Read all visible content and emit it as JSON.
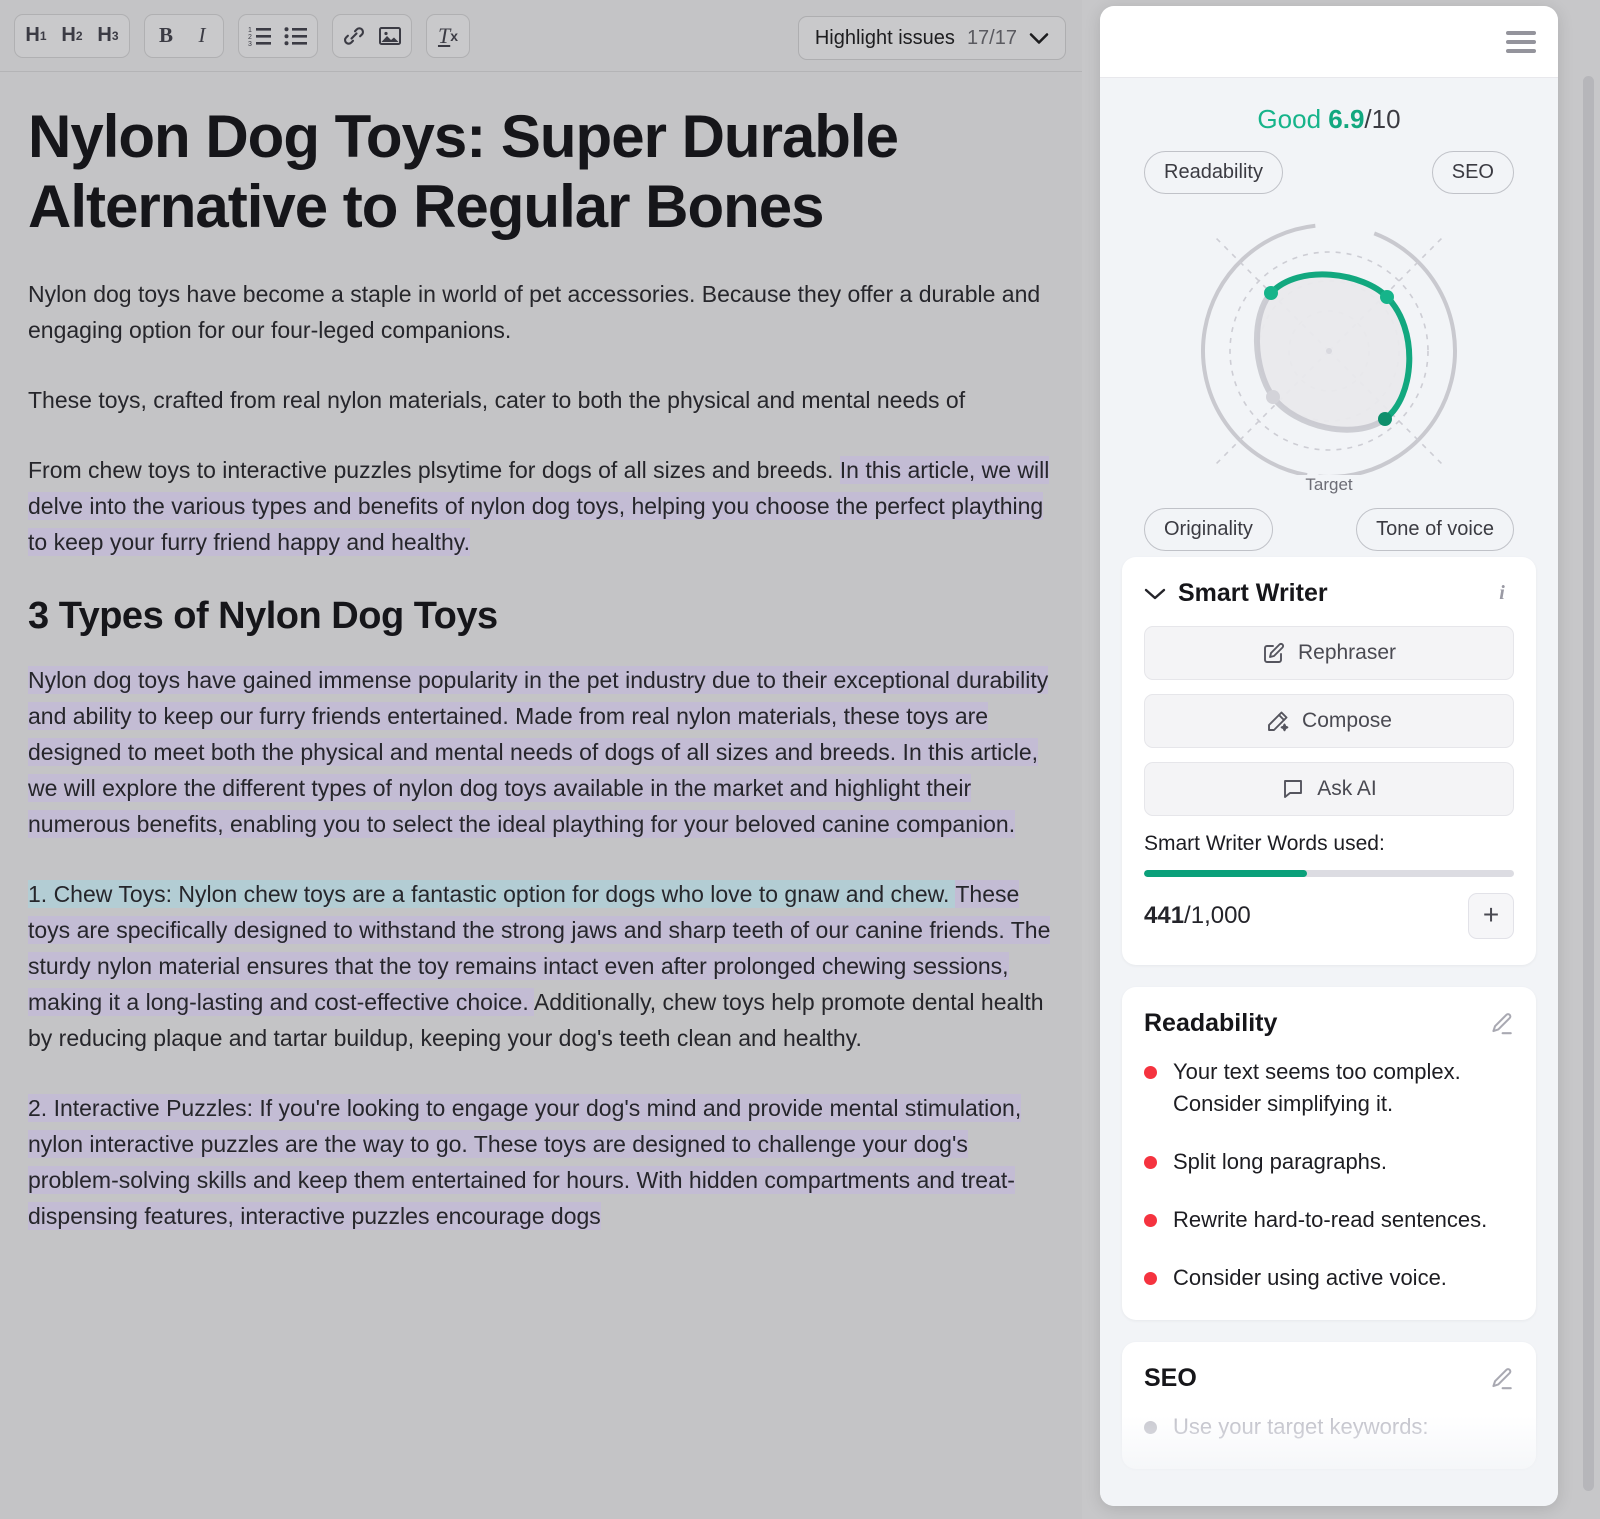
{
  "toolbar": {
    "heading_buttons": [
      {
        "name": "h1",
        "label": "H",
        "sub": "1"
      },
      {
        "name": "h2",
        "label": "H",
        "sub": "2"
      },
      {
        "name": "h3",
        "label": "H",
        "sub": "3"
      }
    ],
    "bold_label": "B",
    "italic_label": "I",
    "ordered_list_icon": "ordered-list-icon",
    "bullet_list_icon": "bullet-list-icon",
    "link_icon": "link-icon",
    "image_icon": "image-icon",
    "clear_format_label": "T",
    "clear_format_sub": "x",
    "highlight_issues": {
      "label": "Highlight issues",
      "count": "17/17",
      "chevron_icon": "chevron-down-icon"
    }
  },
  "document": {
    "title": "Nylon Dog Toys: Super Durable Alternative to Regular Bones",
    "paragraph_1": "Nylon dog toys have become a staple in world of pet accessories. Because they offer a durable and engaging option for our four-leged companions.",
    "paragraph_2": "These toys, crafted from real nylon materials, cater to both the physical and mental needs of",
    "paragraph_3_plain": "From chew toys to interactive puzzles plsytime for dogs of all sizes and breeds. ",
    "paragraph_3_marked": "In this article, we will delve into the various types and benefits of nylon dog toys, helping you choose the perfect plaything to keep your furry friend happy and healthy.",
    "heading_2": "3 Types of Nylon Dog Toys",
    "paragraph_4_marked": "Nylon dog toys have gained immense popularity in the pet industry due to their exceptional durability and ability to keep our furry friends entertained. Made from real nylon materials, these toys are designed to meet both the physical and mental needs of dogs of all sizes and breeds. In this article, we will explore the different types of nylon dog toys available in the market and highlight their numerous benefits, enabling you to select the ideal plaything for your beloved canine companion.",
    "paragraph_5_ai": "1. Chew Toys: Nylon chew toys are a fantastic option for dogs who love to gnaw and chew. ",
    "paragraph_5_marked": "These toys are specifically designed to withstand the strong jaws and sharp teeth of our canine friends. The sturdy nylon material ensures that the toy remains intact even after prolonged chewing sessions, making it a long-lasting and cost-effective choice. ",
    "paragraph_5_plain": "Additionally, chew toys help promote dental health by reducing plaque and tartar buildup, keeping your dog's teeth clean and healthy.",
    "paragraph_6_marked": "2. Interactive Puzzles: If you're looking to engage your dog's mind and provide mental stimulation, nylon interactive puzzles are the way to go. These toys are designed to challenge your dog's problem-solving skills and keep them entertained for hours. With hidden compartments and treat-dispensing features, interactive puzzles encourage dogs"
  },
  "sidebar": {
    "menu_icon": "hamburger-menu-icon",
    "score": {
      "quality_label": "Good",
      "value": "6.9",
      "denominator": "/10",
      "accent_color": "#12a87f"
    },
    "chips": {
      "readability": "Readability",
      "seo": "SEO",
      "originality": "Originality",
      "tone_of_voice": "Tone of voice"
    },
    "target_label": "Target",
    "smart_writer": {
      "title": "Smart Writer",
      "collapse_icon": "chevron-down-icon",
      "info_icon": "info-icon",
      "buttons": [
        {
          "label": "Rephraser",
          "icon": "edit-square-icon"
        },
        {
          "label": "Compose",
          "icon": "magic-wand-icon"
        },
        {
          "label": "Ask AI",
          "icon": "chat-bubble-icon"
        }
      ],
      "words_label": "Smart Writer Words used:",
      "used": "441",
      "limit": "/1,000",
      "progress_percent": 44,
      "add_label": "+"
    },
    "readability": {
      "title": "Readability",
      "edit_icon": "pencil-icon",
      "issues": [
        "Your text seems too complex. Consider simplifying it.",
        "Split long paragraphs.",
        "Rewrite hard-to-read sentences.",
        "Consider using active voice."
      ]
    },
    "seo": {
      "title": "SEO",
      "edit_icon": "pencil-icon",
      "issues": [
        "Use your target keywords:"
      ]
    }
  },
  "chart_data": {
    "type": "radar",
    "title": "Content quality radar",
    "categories": [
      "Readability",
      "SEO",
      "Tone of voice",
      "Originality"
    ],
    "values": [
      6.6,
      8.4,
      8.6,
      3.6
    ],
    "target_ring": 10,
    "rmax": 10,
    "grid": "dashed-concentric",
    "series_color": "#12a87f",
    "target_color": "#c9c9cf",
    "axis_angles_deg": [
      135,
      45,
      315,
      225
    ],
    "legend": [
      "Target"
    ]
  }
}
